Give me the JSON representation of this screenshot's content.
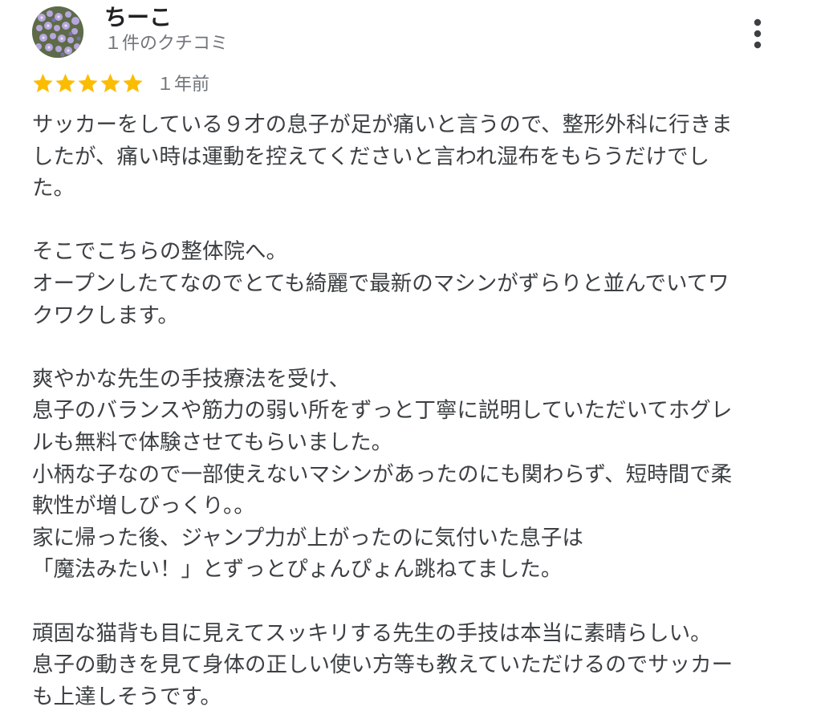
{
  "reviewer": {
    "name": "ちーこ",
    "review_count": "１件のクチコミ",
    "avatar_icon": "flower-photo-avatar"
  },
  "more_menu_icon": "more-vert-icon",
  "rating": {
    "stars": 5,
    "max_stars": 5,
    "star_color": "#fbbc04",
    "time_ago": "１年前"
  },
  "review": {
    "lines": [
      "サッカーをしている９才の息子が足が痛いと言うので、整形外科に行きま",
      "したが、痛い時は運動を控えてくださいと言われ湿布をもらうだけでし",
      "た。",
      "",
      "そこでこちらの整体院へ。",
      "オープンしたてなのでとても綺麗で最新のマシンがずらりと並んでいてワ",
      "クワクします。",
      "",
      "爽やかな先生の手技療法を受け、",
      "息子のバランスや筋力の弱い所をずっと丁寧に説明していただいてホグレ",
      "ルも無料で体験させてもらいました。",
      "小柄な子なので一部使えないマシンがあったのにも関わらず、短時間で柔",
      "軟性が増しびっくり。。",
      "家に帰った後、ジャンプ力が上がったのに気付いた息子は",
      "「魔法みたい！」とずっとぴょんぴょん跳ねてました。",
      "",
      "頑固な猫背も目に見えてスッキリする先生の手技は本当に素晴らしい。",
      "息子の動きを見て身体の正しい使い方等も教えていただけるのでサッカー",
      "も上達しそうです。"
    ]
  }
}
